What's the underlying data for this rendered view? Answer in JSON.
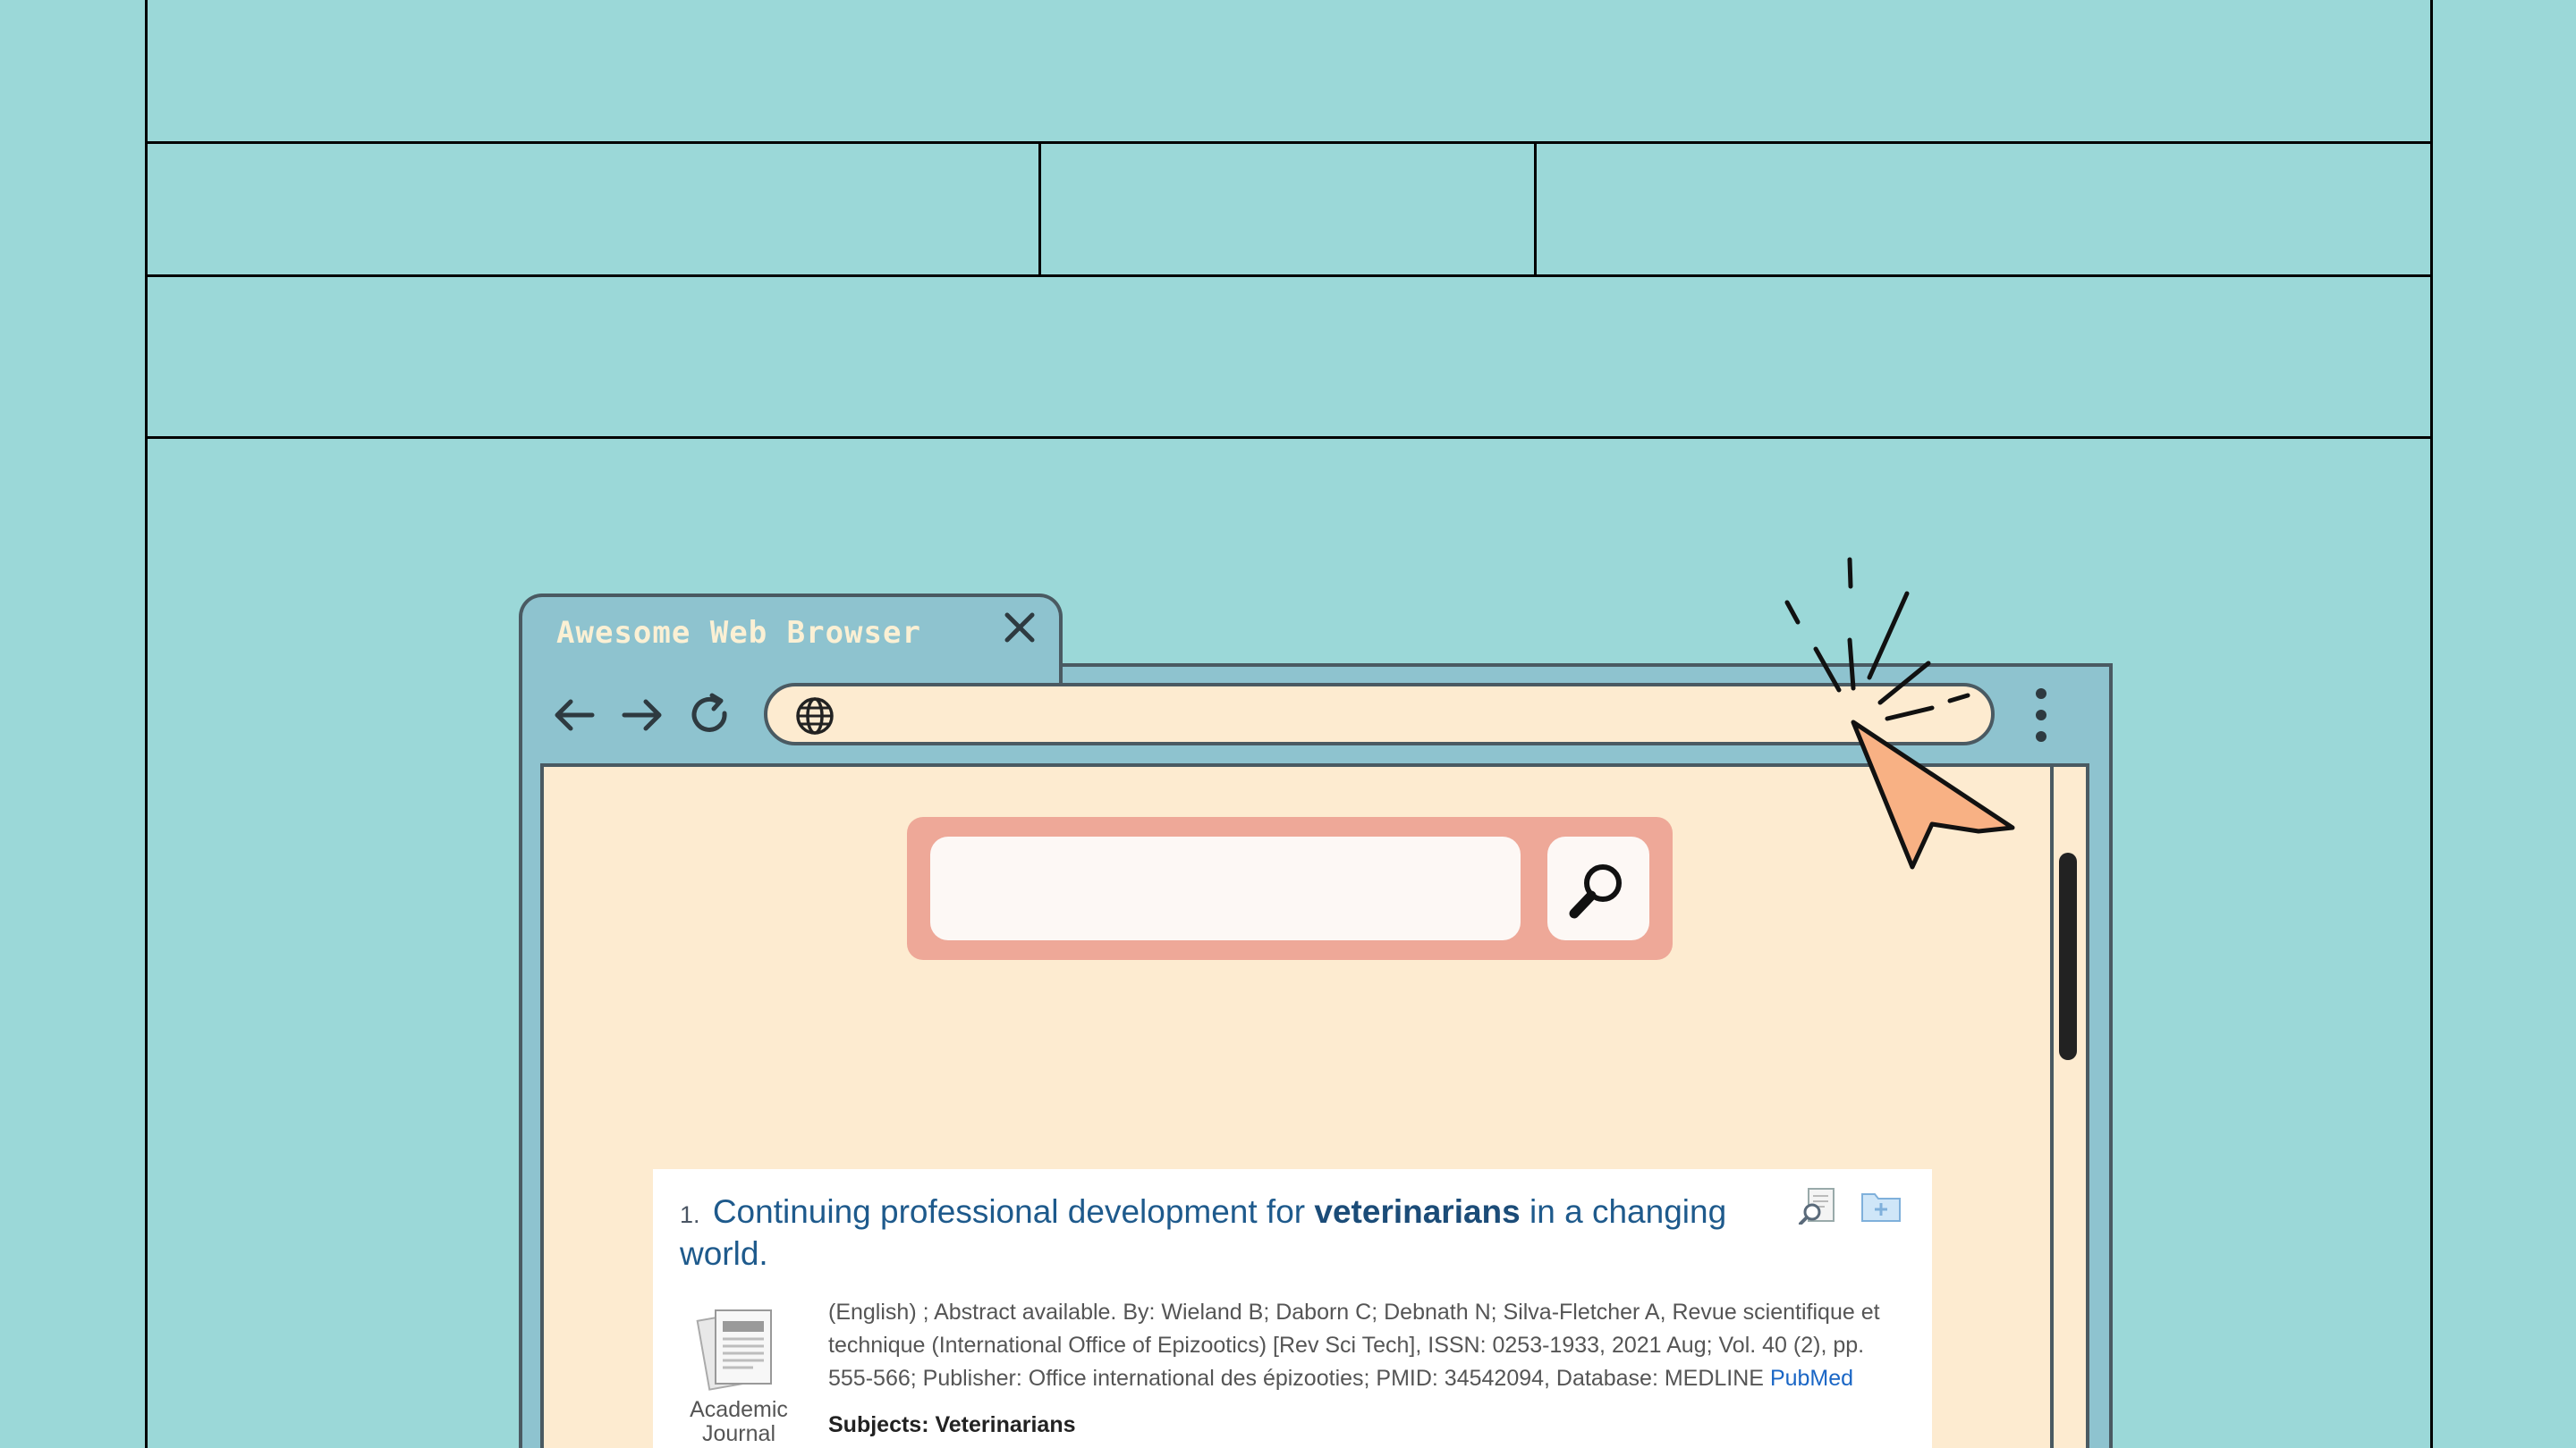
{
  "tab": {
    "title": "Awesome Web Browser",
    "close_icon": "close-icon"
  },
  "toolbar": {
    "back_icon": "arrow-left-icon",
    "forward_icon": "arrow-right-icon",
    "reload_icon": "reload-icon",
    "globe_icon": "globe-icon",
    "menu_icon": "kebab-menu-icon",
    "address_value": ""
  },
  "search": {
    "value": "",
    "button_icon": "search-icon"
  },
  "result": {
    "number": "1.",
    "title_before": "Continuing professional development for",
    "title_highlight": "veterinarians",
    "title_after": "in a changing world.",
    "doc_type": "Academic Journal",
    "meta": "(English) ; Abstract available. By: Wieland B; Daborn C; Debnath N; Silva-Fletcher A, Revue scientifique et technique (International Office of Epizootics) [Rev Sci Tech], ISSN: 0253-1933, 2021 Aug; Vol. 40 (2), pp. 555-566; Publisher: Office international des épizooties; PMID: 34542094, Database: MEDLINE",
    "pubmed_link": "PubMed",
    "subjects_label": "Subjects:",
    "subjects_value": "Veterinarians"
  },
  "colors": {
    "background": "#9bd8d8",
    "browser_chrome": "#8ec3cf",
    "page": "#fdebd0",
    "search_frame": "#eea898",
    "cursor": "#f8b184",
    "link": "#1e5a8c"
  }
}
